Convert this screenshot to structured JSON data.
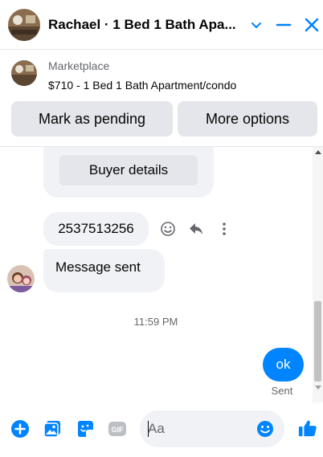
{
  "header": {
    "title": "Rachael · 1 Bed 1 Bath Apa...",
    "icons": [
      "chevron-down-icon",
      "minimize-icon",
      "close-icon"
    ]
  },
  "listing": {
    "source": "Marketplace",
    "title": "$710 - 1 Bed 1 Bath Apartment/condo",
    "mark_pending_label": "Mark as pending",
    "more_options_label": "More options"
  },
  "messages": {
    "buyer_details_label": "Buyer details",
    "phone": "2537513256",
    "message_sent": "Message sent",
    "timestamp": "11:59 PM",
    "my_message": "ok",
    "status": "Sent"
  },
  "composer": {
    "placeholder": "Aa",
    "icons": [
      "plus-icon",
      "gallery-icon",
      "sticker-icon",
      "gif-icon",
      "emoji-icon",
      "thumbs-up-icon"
    ]
  },
  "colors": {
    "accent": "#0084ff",
    "bubble_gray": "#f0f2f5",
    "button_gray": "#e4e6eb",
    "secondary_text": "#65676b"
  }
}
